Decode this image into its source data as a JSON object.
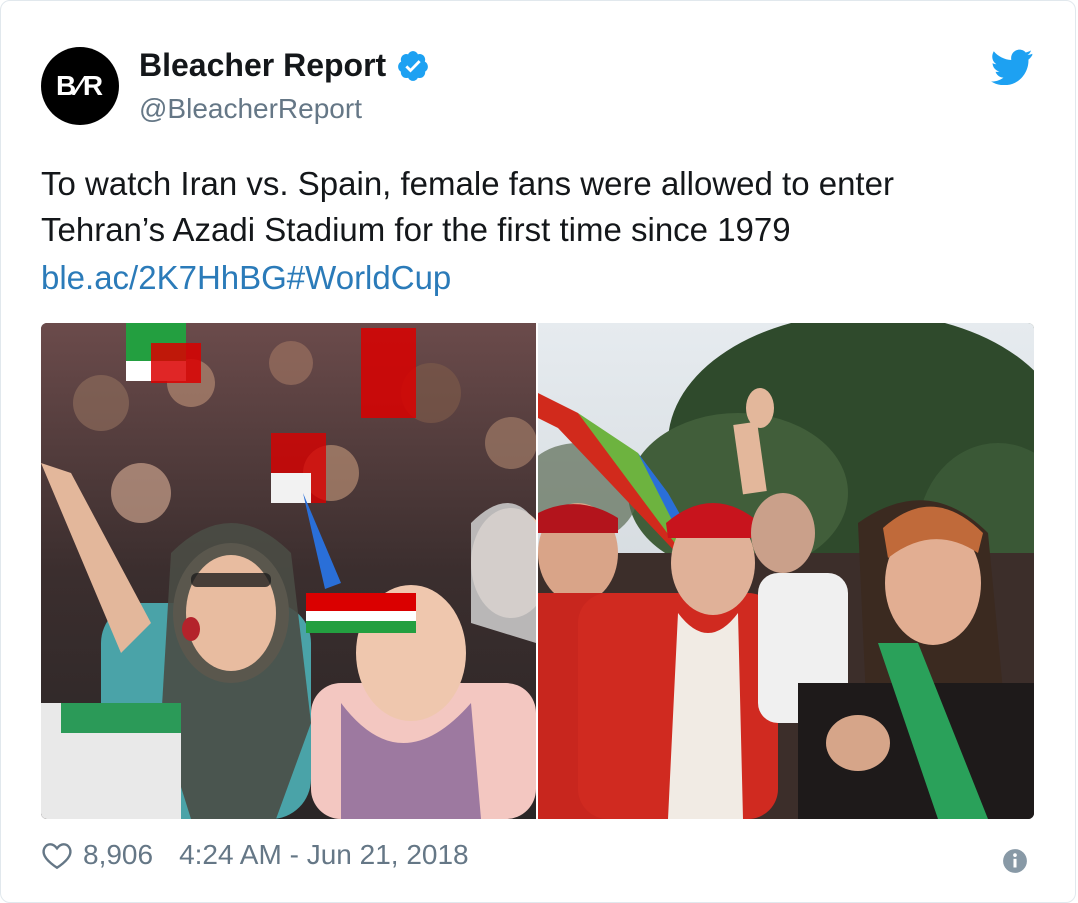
{
  "author": {
    "avatar_text": "B⁄R",
    "display_name": "Bleacher Report",
    "handle": "@BleacherReport",
    "verified_icon": "verified-badge-icon"
  },
  "brand_icon": "twitter-bird-icon",
  "tweet": {
    "text": "To watch Iran vs. Spain, female fans were allowed to enter Tehran’s Azadi Stadium for the first time since 1979",
    "link": "ble.ac/2K7HhBG#WorldCup"
  },
  "media": {
    "images": [
      {
        "name": "photo-left",
        "icon": "image"
      },
      {
        "name": "photo-right",
        "icon": "image"
      }
    ]
  },
  "footer": {
    "likes": "8,906",
    "timestamp": "4:24 AM - Jun 21, 2018",
    "heart_icon": "heart-icon",
    "info_icon": "info-icon"
  },
  "colors": {
    "link": "#2b7bb9",
    "verified": "#1da1f2",
    "secondary_text": "#657786"
  }
}
